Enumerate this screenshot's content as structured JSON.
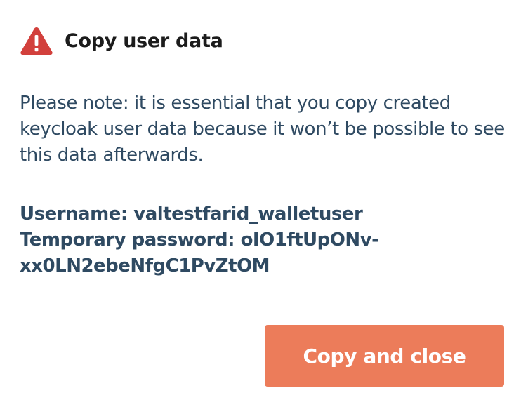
{
  "dialog": {
    "title": "Copy user data",
    "icon": "warning-triangle-icon",
    "note": "Please note: it is essential that you copy created keycloak user data because it won’t be possible to see this data afterwards.",
    "username_label": "Username:",
    "username_value": "valtestfarid_walletuser",
    "password_label": "Temporary password:",
    "password_value_part1": "oIO1ftUpONv-",
    "password_value_part2": "xx0LN2ebeNfgC1PvZtOM",
    "button_label": "Copy and close"
  },
  "colors": {
    "accent": "#ec7c5a",
    "warning": "#d2403c",
    "text": "#2f4a62",
    "title": "#1c1c1c"
  }
}
